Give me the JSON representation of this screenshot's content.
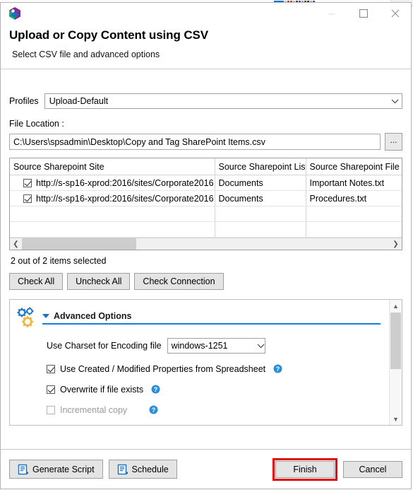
{
  "window": {
    "app_icon": "cube-logo-icon",
    "minimize_label": "Minimize",
    "maximize_label": "Maximize",
    "close_label": "Close"
  },
  "header": {
    "title": "Upload or Copy Content using CSV",
    "subtitle": "Select CSV file and advanced options"
  },
  "profiles": {
    "label": "Profiles",
    "selected": "Upload-Default"
  },
  "file_location": {
    "label": "File Location :",
    "value": "C:\\Users\\spsadmin\\Desktop\\Copy and Tag SharePoint Items.csv",
    "browse_label": "..."
  },
  "grid": {
    "columns": [
      "Source Sharepoint Site",
      "Source Sharepoint List",
      "Source Sharepoint File"
    ],
    "rows": [
      {
        "checked": true,
        "site": "http://s-sp16-xprod:2016/sites/Corporate2016",
        "list": "Documents",
        "file": "Important Notes.txt"
      },
      {
        "checked": true,
        "site": "http://s-sp16-xprod:2016/sites/Corporate2016",
        "list": "Documents",
        "file": "Procedures.txt"
      },
      {
        "checked": null,
        "site": "",
        "list": "",
        "file": ""
      },
      {
        "checked": null,
        "site": "",
        "list": "",
        "file": ""
      }
    ],
    "status": "2 out of 2 items selected"
  },
  "grid_actions": {
    "check_all": "Check All",
    "uncheck_all": "Uncheck All",
    "check_connection": "Check Connection"
  },
  "advanced": {
    "icon": "gears-icon",
    "title": "Advanced Options",
    "expanded": true,
    "charset": {
      "label": "Use Charset for Encoding file",
      "selected": "windows-1251"
    },
    "options": [
      {
        "label": "Use Created / Modified Properties from Spreadsheet",
        "checked": true,
        "enabled": true,
        "help": true
      },
      {
        "label": "Overwrite if file exists",
        "checked": true,
        "enabled": true,
        "help": true
      },
      {
        "label": "Incremental copy",
        "checked": false,
        "enabled": false,
        "help": true
      }
    ]
  },
  "footer": {
    "generate_script": "Generate Script",
    "schedule": "Schedule",
    "finish": "Finish",
    "cancel": "Cancel",
    "finish_highlight_color": "#e00000"
  },
  "colors": {
    "accent_blue": "#1c7fd6",
    "gear_blue": "#2079c8",
    "gear_yellow": "#f2b544",
    "help_blue": "#2a8fd8",
    "logo_green": "#1aab7a",
    "logo_purple": "#7b2f8e",
    "logo_blue": "#1473c9"
  }
}
